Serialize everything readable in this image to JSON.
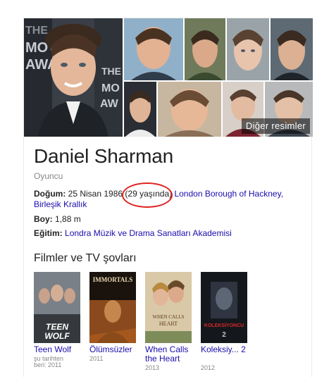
{
  "knowledge_panel": {
    "more_images_label": "Diğer resimler",
    "name": "Daniel Sharman",
    "subtitle": "Oyuncu",
    "facts": {
      "birth": {
        "label": "Doğum:",
        "date": "25 Nisan 1986",
        "age": "(29 yaşında)",
        "place": "London Borough of Hackney,",
        "country": "Birleşik Krallık"
      },
      "height": {
        "label": "Boy:",
        "value": "1,88 m"
      },
      "education": {
        "label": "Eğitim:",
        "value": "Londra Müzik ve Drama Sanatları Akademisi"
      }
    },
    "films_section_title": "Filmler ve TV şovları",
    "films": [
      {
        "title": "Teen Wolf",
        "meta_line1": "şu tarihten",
        "meta_line2": "beri: 2011",
        "poster_text": "TEEN WOLF"
      },
      {
        "title": "Ölümsüzler",
        "meta_line1": "2011",
        "meta_line2": "",
        "poster_text": "IMMORTALS"
      },
      {
        "title": "When Calls the Heart",
        "meta_line1": "2013",
        "meta_line2": "",
        "poster_text": "WHEN CALLS THE HEART"
      },
      {
        "title": "Koleksiy... 2",
        "meta_line1": "2012",
        "meta_line2": "",
        "poster_text": "KOLEKSİYONCU"
      }
    ],
    "colors": {
      "link": "#1a0dab",
      "annotation_circle": "#e02020",
      "muted": "#878787"
    },
    "mosaic_logo_text": [
      "THE",
      "MOV",
      "AWA"
    ]
  }
}
